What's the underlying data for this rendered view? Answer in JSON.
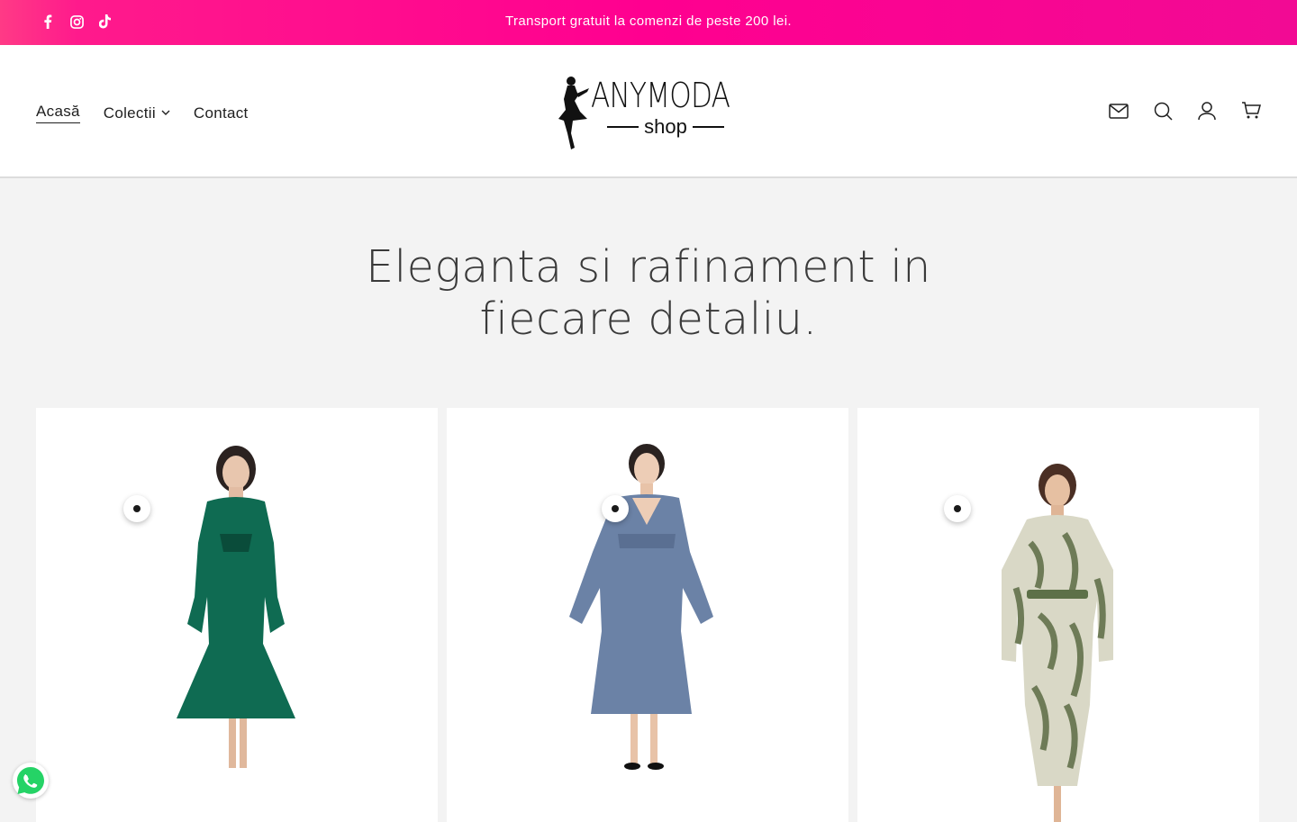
{
  "announcement": {
    "text": "Transport gratuit la comenzi de peste 200 lei.",
    "socials": [
      "facebook-icon",
      "instagram-icon",
      "tiktok-icon"
    ]
  },
  "header": {
    "nav": [
      {
        "label": "Acasă",
        "active": true
      },
      {
        "label": "Colectii",
        "has_dropdown": true
      },
      {
        "label": "Contact"
      }
    ],
    "logo": {
      "wordmark": "ANYMODA",
      "subtext": "shop"
    },
    "icons": [
      "mail-icon",
      "search-icon",
      "account-icon",
      "cart-icon"
    ]
  },
  "hero": {
    "title": "Eleganta si rafinament in fiecare detaliu."
  },
  "products": [
    {
      "image": "green-satin-dress",
      "color": "#0f6b52"
    },
    {
      "image": "blue-pleated-dress",
      "color": "#6b82a6"
    },
    {
      "image": "zebra-print-dress",
      "color": "#6e7b57"
    }
  ],
  "colors": {
    "announcement_bg": "#ff0090",
    "page_bg": "#f3f3f3",
    "whatsapp": "#25d366"
  }
}
